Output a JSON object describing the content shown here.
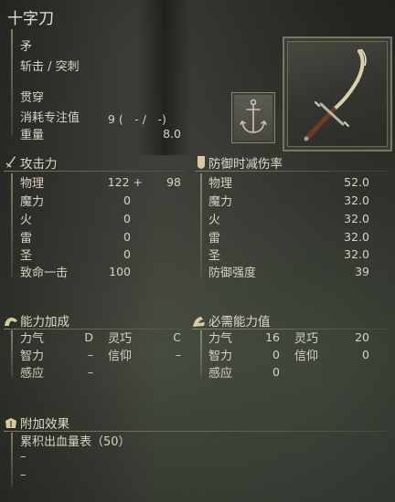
{
  "weapon": {
    "name": "十字刀",
    "type": "矛",
    "attack_type": "斩击 / 突刺",
    "skill_name": "贯穿",
    "fp_cost_label": "消耗专注值",
    "fp_cost_value": "9 (　- /　-)",
    "weight_label": "重量",
    "weight_value": "8.0",
    "image_icon": "cross-naginata-icon",
    "skill_icon": "anchor-skill-icon"
  },
  "attack": {
    "title": "攻击力",
    "icon": "sword-icon",
    "rows": [
      {
        "label": "物理",
        "value": "122 +",
        "extra": "98"
      },
      {
        "label": "魔力",
        "value": "0",
        "extra": ""
      },
      {
        "label": "火",
        "value": "0",
        "extra": ""
      },
      {
        "label": "雷",
        "value": "0",
        "extra": ""
      },
      {
        "label": "圣",
        "value": "0",
        "extra": ""
      },
      {
        "label": "致命一击",
        "value": "100",
        "extra": ""
      }
    ]
  },
  "defense": {
    "title": "防御时减伤率",
    "icon": "shield-icon",
    "rows": [
      {
        "label": "物理",
        "value": "52.0"
      },
      {
        "label": "魔力",
        "value": "32.0"
      },
      {
        "label": "火",
        "value": "32.0"
      },
      {
        "label": "雷",
        "value": "32.0"
      },
      {
        "label": "圣",
        "value": "32.0"
      },
      {
        "label": "防御强度",
        "value": "39"
      }
    ]
  },
  "scaling": {
    "title": "能力加成",
    "icon": "scaling-icon",
    "rows": [
      {
        "label1": "力气",
        "val1": "D",
        "label2": "灵巧",
        "val2": "C"
      },
      {
        "label1": "智力",
        "val1": "–",
        "label2": "信仰",
        "val2": "–"
      },
      {
        "label1": "感应",
        "val1": "–",
        "label2": "",
        "val2": ""
      }
    ]
  },
  "requirements": {
    "title": "必需能力值",
    "icon": "requirement-icon",
    "rows": [
      {
        "label1": "力气",
        "val1": "16",
        "label2": "灵巧",
        "val2": "20"
      },
      {
        "label1": "智力",
        "val1": "0",
        "label2": "信仰",
        "val2": "0"
      },
      {
        "label1": "感应",
        "val1": "0",
        "label2": "",
        "val2": ""
      }
    ]
  },
  "effects": {
    "title": "附加效果",
    "icon": "effect-icon",
    "items": [
      "累积出血量表（50）",
      "–",
      "–"
    ]
  }
}
